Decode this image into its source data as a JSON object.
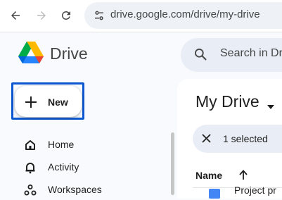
{
  "browser": {
    "url": "drive.google.com/drive/my-drive",
    "icons": {
      "back": "back-arrow-icon",
      "forward": "forward-arrow-icon",
      "reload": "reload-icon",
      "site_info": "tune-icon"
    }
  },
  "app": {
    "name": "Drive",
    "logo": "google-drive-logo"
  },
  "search": {
    "placeholder": "Search in Dr",
    "icon": "search-icon"
  },
  "new_button": {
    "label": "New",
    "icon": "plus-icon",
    "focus_color": "#0b57d0"
  },
  "sidebar": {
    "items": [
      {
        "label": "Home",
        "icon": "home-icon"
      },
      {
        "label": "Activity",
        "icon": "bell-icon"
      },
      {
        "label": "Workspaces",
        "icon": "workspaces-icon"
      }
    ]
  },
  "main": {
    "title": "My Drive",
    "selection": {
      "text": "1 selected",
      "icon": "close-icon"
    },
    "columns": [
      {
        "label": "Name",
        "sort_icon": "arrow-up-icon"
      }
    ],
    "rows": [
      {
        "name": "Project pr",
        "icon": "file-icon"
      }
    ]
  },
  "colors": {
    "accent": "#0b57d0",
    "background": "#f8fafd",
    "surface": "#ffffff",
    "pill": "#e9eef6"
  }
}
